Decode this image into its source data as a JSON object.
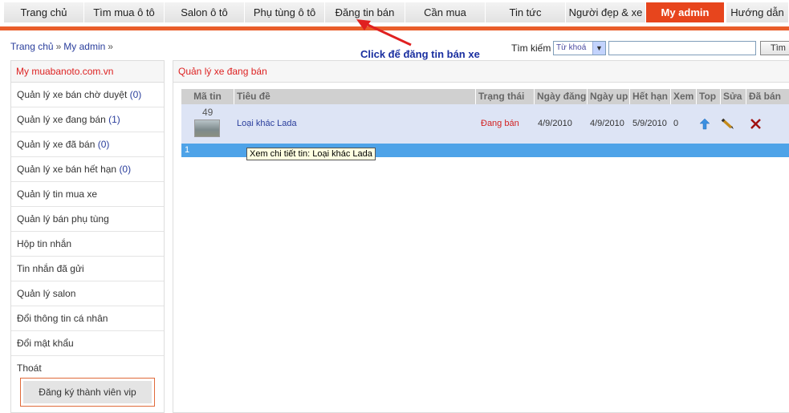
{
  "nav": {
    "items": [
      "Trang chủ",
      "Tìm mua ô tô",
      "Salon ô tô",
      "Phụ tùng ô tô",
      "Đăng tin bán",
      "Cần mua",
      "Tin tức",
      "Người đẹp & xe",
      "My admin",
      "Hướng dẫn"
    ],
    "active": "My admin"
  },
  "breadcrumb": {
    "home": "Trang chủ",
    "current": "My admin",
    "sep": "»"
  },
  "annotation": "Click để đăng tin bán xe",
  "search": {
    "label": "Tìm kiếm",
    "select_value": "Từ khoá",
    "button": "Tìm"
  },
  "sidebar": {
    "title": "My muabanoto.com.vn",
    "items": [
      {
        "label": "Quản lý xe bán chờ duyệt ",
        "count": "(0)"
      },
      {
        "label": "Quản lý xe đang bán ",
        "count": "(1)"
      },
      {
        "label": "Quản lý xe đã bán ",
        "count": "(0)"
      },
      {
        "label": "Quản lý xe bán hết hạn ",
        "count": "(0)"
      },
      {
        "label": "Quản lý tin mua xe",
        "count": ""
      },
      {
        "label": "Quản lý bán phụ tùng",
        "count": ""
      },
      {
        "label": "Hộp tin nhắn",
        "count": ""
      },
      {
        "label": "Tin nhắn đã gửi",
        "count": ""
      },
      {
        "label": "Quản lý salon",
        "count": ""
      },
      {
        "label": "Đổi thông tin cá nhân",
        "count": ""
      },
      {
        "label": "Đổi mật khẩu",
        "count": ""
      },
      {
        "label": "Thoát",
        "count": ""
      }
    ],
    "vip_button": "Đăng ký thành viên vip"
  },
  "main": {
    "title": "Quản lý xe đang bán",
    "columns": [
      "Mã tin",
      "Tiêu đề",
      "Trạng thái",
      "Ngày đăng",
      "Ngày up",
      "Hết hạn",
      "Xem",
      "Top",
      "Sửa",
      "Đã bán"
    ],
    "rows": [
      {
        "id": "49",
        "title": "Loại khác Lada",
        "status": "Đang bán",
        "posted": "4/9/2010",
        "up": "4/9/2010",
        "expires": "5/9/2010",
        "views": "0"
      }
    ],
    "page": "1",
    "tooltip": "Xem chi tiết tin: Loại khác Lada"
  },
  "colors": {
    "accent": "#e7451d",
    "link": "#2a3e9c",
    "status": "#d22222",
    "pager": "#4ea3e8"
  }
}
